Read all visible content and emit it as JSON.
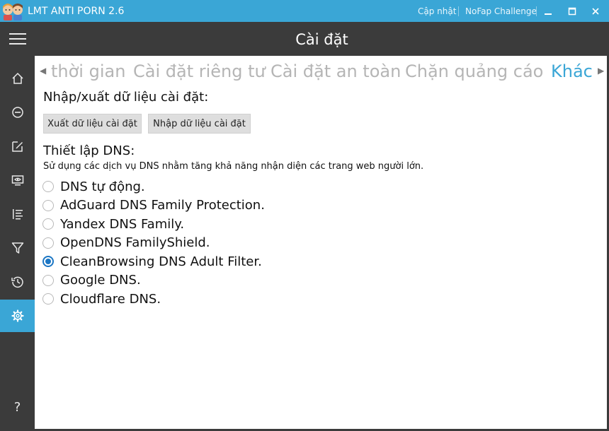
{
  "window": {
    "title": "LMT ANTI PORN 2.6",
    "links": [
      "Cập nhật",
      "NoFap Challenge"
    ],
    "controls": [
      "minimize-icon",
      "maximize-icon",
      "close-icon"
    ]
  },
  "sidebar": {
    "items": [
      {
        "icon": "menu-icon",
        "active": false
      },
      {
        "icon": "home-icon",
        "active": false
      },
      {
        "icon": "block-icon",
        "active": false
      },
      {
        "icon": "edit-icon",
        "active": false
      },
      {
        "icon": "screen-monitor-icon",
        "active": false
      },
      {
        "icon": "list-icon",
        "active": false
      },
      {
        "icon": "filter-icon",
        "active": false
      },
      {
        "icon": "history-icon",
        "active": false
      },
      {
        "icon": "settings-icon",
        "active": true
      },
      {
        "icon": "help-icon",
        "active": false
      }
    ],
    "help_label": "?"
  },
  "header": {
    "title": "Cài đặt"
  },
  "tabs": {
    "items": [
      "thời gian",
      "Cài đặt riêng tư",
      "Cài đặt an toàn",
      "Chặn quảng cáo",
      "Khác"
    ],
    "active": "Khác"
  },
  "import_export": {
    "title": "Nhập/xuất dữ liệu cài đặt:",
    "export_button": "Xuất dữ liệu cài đặt",
    "import_button": "Nhập dữ liệu cài đặt"
  },
  "dns": {
    "title": "Thiết lập DNS:",
    "description": "Sử dụng các dịch vụ DNS nhằm tăng khả năng nhận diện các trang web người lớn.",
    "options": [
      {
        "label": "DNS tự động.",
        "checked": false
      },
      {
        "label": "AdGuard DNS Family Protection.",
        "checked": false
      },
      {
        "label": "Yandex DNS Family.",
        "checked": false
      },
      {
        "label": "OpenDNS FamilyShield.",
        "checked": false
      },
      {
        "label": "CleanBrowsing DNS Adult Filter.",
        "checked": true
      },
      {
        "label": "Google DNS.",
        "checked": false
      },
      {
        "label": "Cloudflare DNS.",
        "checked": false
      }
    ]
  },
  "colors": {
    "accent": "#3aa6d6",
    "sidebar_bg": "#3b3b3b",
    "radio_checked": "#1b76c4",
    "tab_inactive": "#b5b5b5"
  }
}
